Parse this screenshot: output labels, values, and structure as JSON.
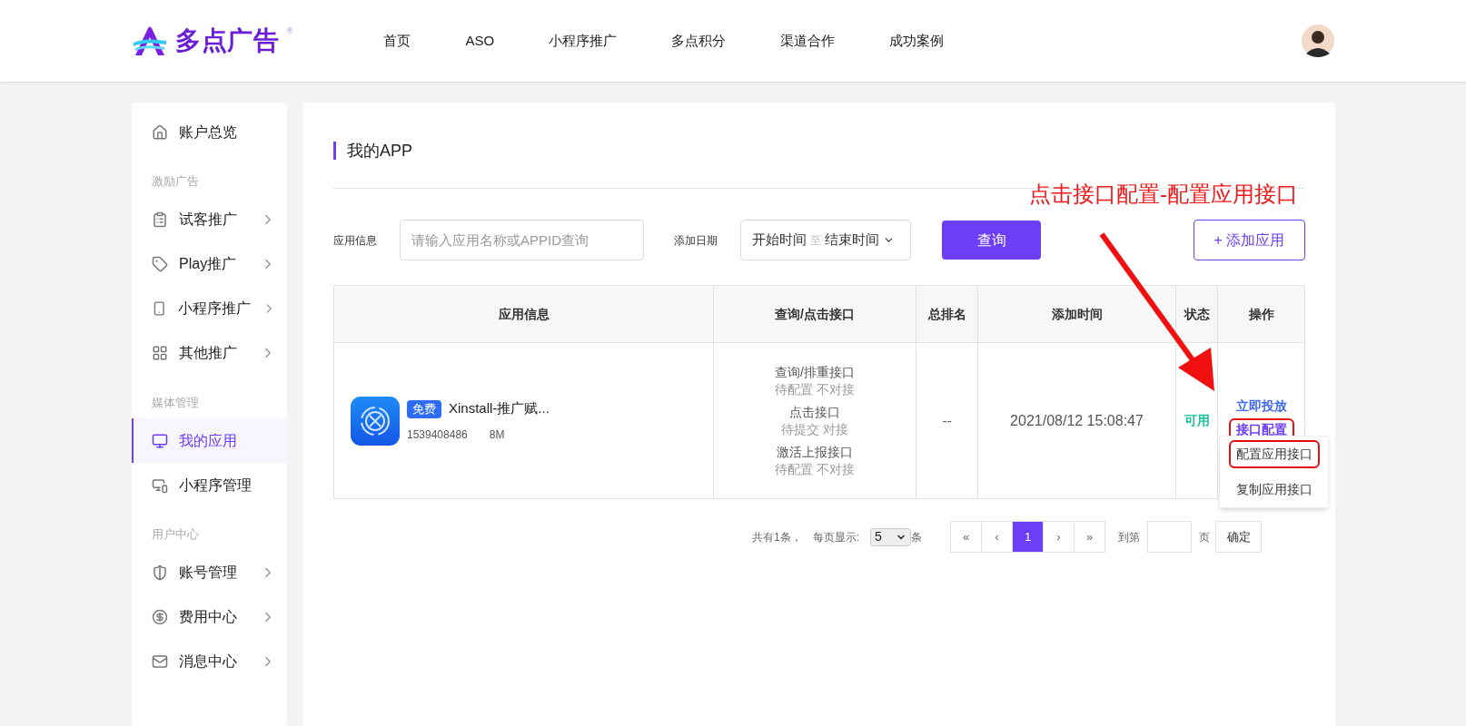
{
  "header": {
    "logo": {
      "text": "多点广告",
      "mark": "®"
    },
    "nav": [
      {
        "label": "首页"
      },
      {
        "label": "ASO"
      },
      {
        "label": "小程序推广"
      },
      {
        "label": "多点积分"
      },
      {
        "label": "渠道合作"
      },
      {
        "label": "成功案例"
      }
    ]
  },
  "sidebar": {
    "groups": [
      {
        "items": [
          {
            "label": "账户总览",
            "expandable": false,
            "selected": false
          }
        ]
      },
      {
        "heading": "激励广告",
        "items": [
          {
            "label": "试客推广",
            "expandable": true,
            "selected": false
          },
          {
            "label": "Play推广",
            "expandable": true,
            "selected": false
          },
          {
            "label": "小程序推广",
            "expandable": true,
            "selected": false
          },
          {
            "label": "其他推广",
            "expandable": true,
            "selected": false
          }
        ]
      },
      {
        "heading": "媒体管理",
        "items": [
          {
            "label": "我的应用",
            "expandable": false,
            "selected": true
          },
          {
            "label": "小程序管理",
            "expandable": false,
            "selected": false
          }
        ]
      },
      {
        "heading": "用户中心",
        "items": [
          {
            "label": "账号管理",
            "expandable": true,
            "selected": false
          },
          {
            "label": "费用中心",
            "expandable": true,
            "selected": false
          },
          {
            "label": "消息中心",
            "expandable": true,
            "selected": false
          }
        ]
      }
    ]
  },
  "main": {
    "title": "我的APP",
    "filters": {
      "app_label": "应用信息",
      "app_placeholder": "请输入应用名称或APPID查询",
      "date_label": "添加日期",
      "date_start": "开始时间",
      "date_sep": "至",
      "date_end": "结束时间",
      "search_button": "查询",
      "add_button": "+ 添加应用"
    },
    "table": {
      "columns": [
        "应用信息",
        "查询/点击接口",
        "总排名",
        "添加时间",
        "状态",
        "操作"
      ],
      "rows": [
        {
          "tag": "免费",
          "name": "Xinstall-推广赋...",
          "app_id": "1539408486",
          "size": "8M",
          "interfaces": [
            {
              "name": "查询/排重接口",
              "status": "待配置 不对接"
            },
            {
              "name": "点击接口",
              "status": "待提交 对接"
            },
            {
              "name": "激活上报接口",
              "status": "待配置 不对接"
            }
          ],
          "rank": "--",
          "added": "2021/08/12 15:08:47",
          "status": "可用",
          "actions": [
            {
              "label": "立即投放",
              "highlighted": false
            },
            {
              "label": "接口配置",
              "highlighted": true
            }
          ]
        }
      ]
    },
    "menu": [
      {
        "label": "配置应用接口",
        "highlighted": true
      },
      {
        "label": "复制应用接口",
        "highlighted": false
      }
    ],
    "pagination": {
      "summary": "共有1条，",
      "per_page_label": "每页显示:",
      "per_page": "5",
      "unit": "条",
      "pages": [
        {
          "label": "«",
          "selected": false
        },
        {
          "label": "‹",
          "selected": false
        },
        {
          "label": "1",
          "selected": true
        },
        {
          "label": "›",
          "selected": false
        },
        {
          "label": "»",
          "selected": false
        }
      ],
      "goto_label": "到第",
      "goto_unit": "页",
      "confirm": "确定"
    }
  },
  "annotation": {
    "text": "点击接口配置-配置应用接口"
  }
}
